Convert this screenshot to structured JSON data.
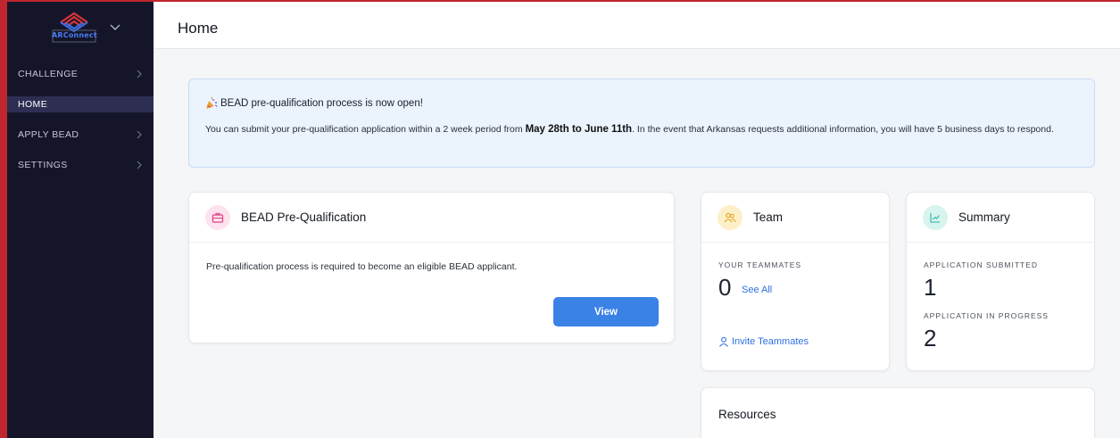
{
  "app": {
    "logo_text": "ARConnect"
  },
  "sidebar": {
    "items": [
      {
        "label": "CHALLENGE",
        "has_chevron": true
      },
      {
        "label": "HOME",
        "active": true
      },
      {
        "label": "APPLY BEAD",
        "has_chevron": true
      },
      {
        "label": "SETTINGS",
        "has_chevron": true
      }
    ]
  },
  "header": {
    "title": "Home"
  },
  "banner": {
    "title": "BEAD pre-qualification process is now open!",
    "body_prefix": "You can submit your pre-qualification application within a 2 week period from ",
    "body_bold": "May 28th to June 11th",
    "body_suffix": ". In the event that Arkansas requests additional information, you will have 5 business days to respond."
  },
  "prequal_card": {
    "title": "BEAD Pre-Qualification",
    "description": "Pre-qualification process is required to become an eligible BEAD applicant.",
    "button_label": "View"
  },
  "team_card": {
    "title": "Team",
    "teammates_label": "YOUR TEAMMATES",
    "teammates_count": "0",
    "see_all_label": "See All",
    "invite_label": "Invite Teammates"
  },
  "summary_card": {
    "title": "Summary",
    "submitted_label": "APPLICATION SUBMITTED",
    "submitted_count": "1",
    "in_progress_label": "APPLICATION IN PROGRESS",
    "in_progress_count": "2"
  },
  "resources_card": {
    "title": "Resources"
  },
  "colors": {
    "sidebar_bg": "#15152a",
    "sidebar_active": "#2d2e52",
    "accent": "#3b82e6",
    "link": "#2f6fe0",
    "banner_bg": "#ebf3fd",
    "window_frame": "#c0262d"
  }
}
